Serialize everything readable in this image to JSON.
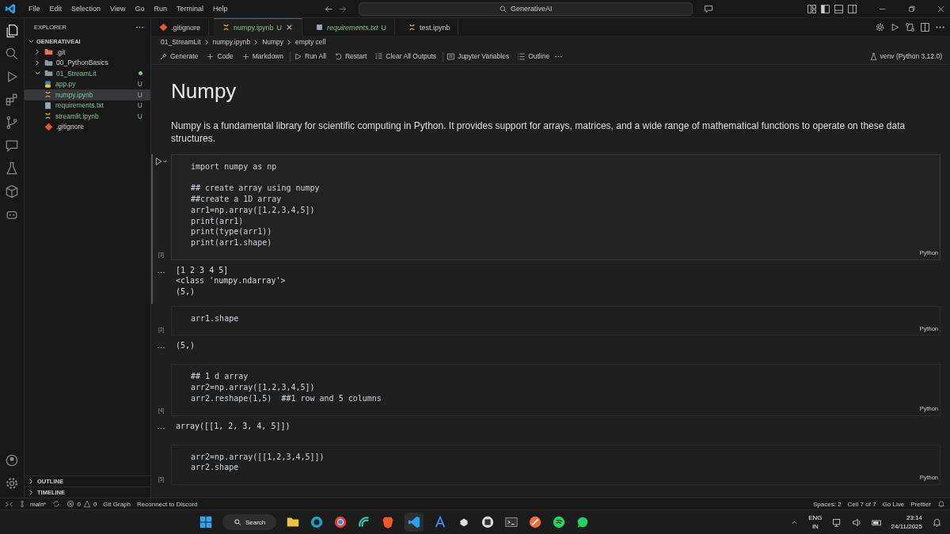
{
  "menu": [
    "File",
    "Edit",
    "Selection",
    "View",
    "Go",
    "Run",
    "Terminal",
    "Help"
  ],
  "command_center": {
    "value": "GenerativeAI"
  },
  "sidebar": {
    "title": "EXPLORER",
    "root": "GENERATIVEAI",
    "tree": [
      {
        "label": ".git",
        "kind": "folder",
        "expanded": false
      },
      {
        "label": "00_PythonBasics",
        "kind": "folder",
        "expanded": false
      },
      {
        "label": "01_StreamLit",
        "kind": "folder",
        "expanded": true,
        "modified": true,
        "children": [
          {
            "label": "app.py",
            "kind": "python",
            "selected": false,
            "status": "U"
          },
          {
            "label": "numpy.ipynb",
            "kind": "notebook",
            "selected": true,
            "status": "U"
          },
          {
            "label": "requirements.txt",
            "kind": "text",
            "selected": false,
            "status": "U"
          },
          {
            "label": "streamlit.ipynb",
            "kind": "notebook",
            "selected": false,
            "status": "U"
          }
        ]
      },
      {
        "label": ".gitignore",
        "kind": "git"
      }
    ],
    "sections": [
      "OUTLINE",
      "TIMELINE"
    ]
  },
  "tabs": [
    {
      "label": ".gitignore",
      "kind": "git",
      "selected": false,
      "preview": false
    },
    {
      "label": "numpy.ipynb",
      "kind": "notebook",
      "selected": true,
      "status": "U",
      "preview": false
    },
    {
      "label": "requirements.txt",
      "kind": "text",
      "selected": false,
      "status": "U",
      "preview": true
    },
    {
      "label": "test.ipynb",
      "kind": "notebook",
      "selected": false,
      "preview": false
    }
  ],
  "breadcrumbs": [
    "01_StreamLit",
    "numpy.ipynb",
    "Numpy",
    "empty cell"
  ],
  "toolbar": [
    "Generate",
    "Code",
    "Markdown",
    "Run All",
    "Restart",
    "Clear All Outputs",
    "Jupyter Variables",
    "Outline"
  ],
  "kernel": "venv (Python 3.12.0)",
  "heading": "Numpy",
  "paragraph": "Numpy is a fundamental library for scientific computing in Python. It provides support for arrays, matrices, and a wide range of mathematical functions to operate on these data structures.",
  "cells": [
    {
      "selected": true,
      "count": "[3]",
      "language": "Python",
      "code": [
        "import numpy as np\n\n## create array using numpy\n##create a 1D array\narr1=np.array([1,2,3,4,5])\nprint(arr1)\nprint(type(arr1))\nprint(arr1.shape)"
      ],
      "output": [
        "[1 2 3 4 5]",
        "<class 'numpy.ndarray'>",
        "(5,)"
      ]
    },
    {
      "selected": false,
      "count": "[2]",
      "language": "Python",
      "code": [
        "arr1.shape"
      ],
      "output": [
        "(5,)"
      ]
    },
    {
      "selected": false,
      "count": "[4]",
      "language": "Python",
      "code": [
        "## 1 d array",
        "arr2=np.array([1,2,3,4,5])",
        "arr2.reshape(1,5)  ##1 row and 5 columns"
      ],
      "output": [
        "array([[1, 2, 3, 4, 5]])"
      ]
    },
    {
      "selected": false,
      "count": "[5]",
      "language": "Python",
      "code": [
        "arr2=np.array([[1,2,3,4,5]])",
        "arr2.shape"
      ]
    }
  ],
  "status_bar": {
    "branch": "main*",
    "errors": "0",
    "warnings": "0",
    "left": [
      "Git Graph",
      "Reconnect to Discord"
    ],
    "right": [
      "Spaces: 2",
      "Cell 7 of 7",
      "Go Live",
      "Prettier"
    ]
  },
  "taskbar": {
    "search": "Search",
    "language": "ENG",
    "region": "IN",
    "time": "23:14",
    "date": "24/11/2025"
  }
}
